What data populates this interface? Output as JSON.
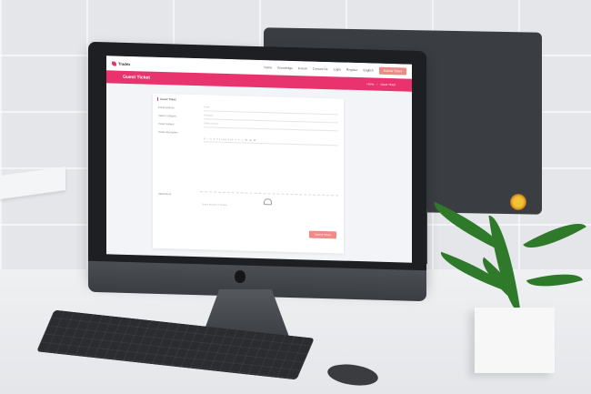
{
  "site": {
    "brand": "Tradex",
    "nav": [
      "Home",
      "Knowledge",
      "Forum",
      "Contact Us",
      "Login",
      "Register",
      "English"
    ],
    "submit_ticket": "Submit Ticket"
  },
  "banner": {
    "title": "Guest Ticket",
    "breadcrumb": [
      "Home",
      "Guest Ticket"
    ]
  },
  "form": {
    "heading": "Guest Ticket",
    "fields": [
      {
        "label": "Email address",
        "placeholder": "Email"
      },
      {
        "label": "Select Category",
        "placeholder": "Category"
      },
      {
        "label": "Ticket Subject",
        "placeholder": "Ticket Subject"
      },
      {
        "label": "Ticket description",
        "placeholder": ""
      }
    ],
    "toolbar": "B  I  U  S  Paragraph  ≡  ≡  ≡  ⌘  ⌘  ⌘",
    "upload_label": "Attachment",
    "upload_hint": "Drag & drop file or browse",
    "send_button": "Submit Ticket"
  },
  "colors": {
    "primary": "#e8336e",
    "button": "#f08a86"
  }
}
